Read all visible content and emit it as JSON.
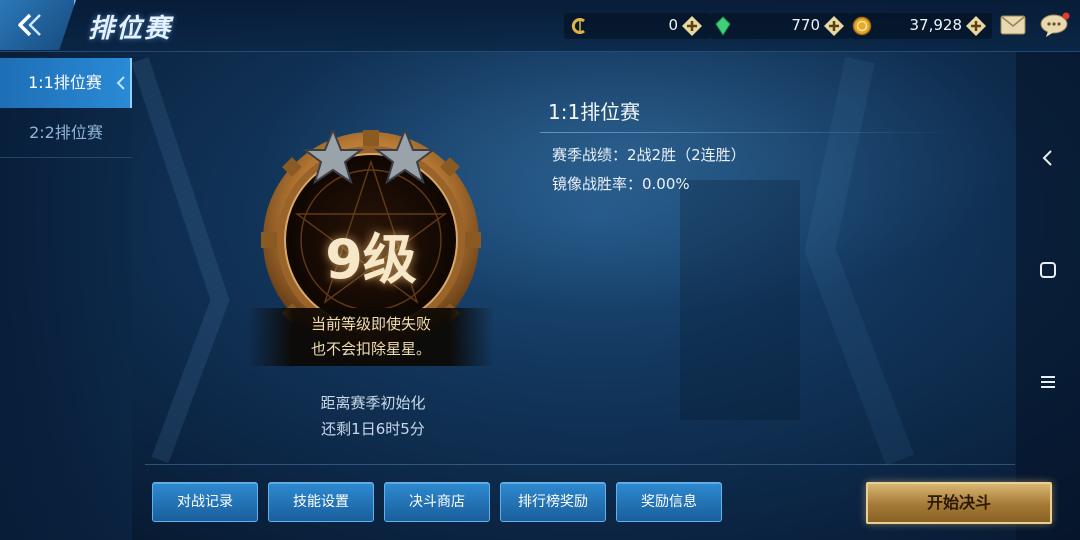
{
  "header": {
    "title": "排位赛",
    "currencies": [
      {
        "name": "coupon",
        "value": "0",
        "icon": "coupon-c-icon",
        "color": "#e0b34a"
      },
      {
        "name": "gem",
        "value": "770",
        "icon": "green-gem-icon",
        "color": "#3fd07a"
      },
      {
        "name": "gold",
        "value": "37,928",
        "icon": "gold-coin-icon",
        "color": "#e7a928"
      }
    ]
  },
  "sidebar": {
    "items": [
      {
        "label": "1:1排位赛",
        "active": true
      },
      {
        "label": "2:2排位赛",
        "active": false
      }
    ]
  },
  "rank": {
    "level": "9级",
    "stars": 2,
    "notice_line1": "当前等级即使失败",
    "notice_line2": "也不会扣除星星。",
    "countdown_line1": "距离赛季初始化",
    "countdown_line2": "还剩1日6时5分"
  },
  "info": {
    "title": "1:1排位赛",
    "season_record": "赛季战绩：2战2胜（2连胜）",
    "mirror_rate": "镜像战胜率：0.00%"
  },
  "buttons": {
    "battle_record": "对战记录",
    "skill_settings": "技能设置",
    "duel_shop": "决斗商店",
    "leaderboard_rewards": "排行榜奖励",
    "reward_info": "奖励信息",
    "start_duel": "开始决斗"
  },
  "colors": {
    "accent_blue": "#2a8ad6",
    "gold": "#d9b572"
  }
}
